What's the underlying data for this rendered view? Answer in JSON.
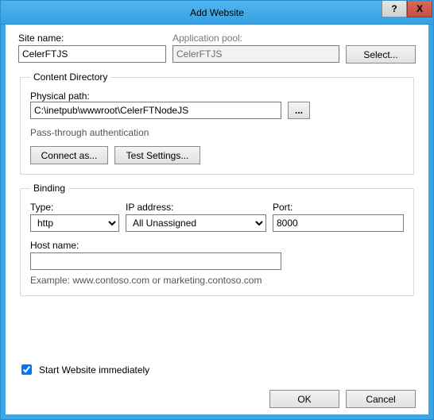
{
  "window": {
    "title": "Add Website",
    "help_glyph": "?",
    "close_glyph": "X"
  },
  "form": {
    "site_name": {
      "label": "Site name:",
      "value": "CelerFTJS"
    },
    "app_pool": {
      "label": "Application pool:",
      "value": "CelerFTJS",
      "select_label": "Select..."
    },
    "content_dir": {
      "legend": "Content Directory",
      "physical_path": {
        "label": "Physical path:",
        "value": "C:\\inetpub\\wwwroot\\CelerFTNodeJS",
        "browse_glyph": "..."
      },
      "pta_label": "Pass-through authentication",
      "connect_as_label": "Connect as...",
      "test_settings_label": "Test Settings..."
    },
    "binding": {
      "legend": "Binding",
      "type": {
        "label": "Type:",
        "value": "http"
      },
      "ip": {
        "label": "IP address:",
        "value": "All Unassigned"
      },
      "port": {
        "label": "Port:",
        "value": "8000"
      },
      "host": {
        "label": "Host name:",
        "value": ""
      },
      "example": "Example: www.contoso.com or marketing.contoso.com"
    },
    "start_immediately": {
      "label": "Start Website immediately",
      "checked": true
    }
  },
  "buttons": {
    "ok": "OK",
    "cancel": "Cancel"
  }
}
